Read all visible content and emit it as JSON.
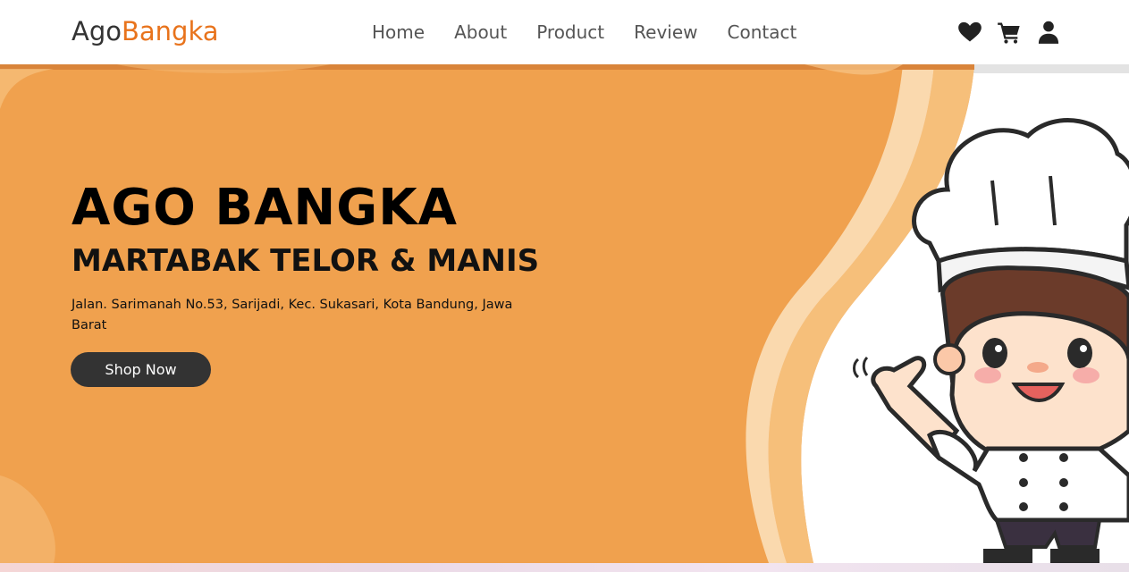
{
  "header": {
    "logo_prefix": "Ago",
    "logo_accent": "Bangka",
    "nav": [
      "Home",
      "About",
      "Product",
      "Review",
      "Contact"
    ],
    "icons": [
      "heart-icon",
      "cart-icon",
      "user-icon"
    ]
  },
  "hero": {
    "title": "AGO BANGKA",
    "subtitle": "MARTABAK TELOR & MANIS",
    "address": "Jalan. Sarimanah No.53, Sarijadi, Kec. Sukasari, Kota Bandung, Jawa Barat",
    "cta": "Shop Now"
  },
  "colors": {
    "accent": "#e8731c",
    "hero_bg": "#f0a14e",
    "button_bg": "#333333"
  }
}
